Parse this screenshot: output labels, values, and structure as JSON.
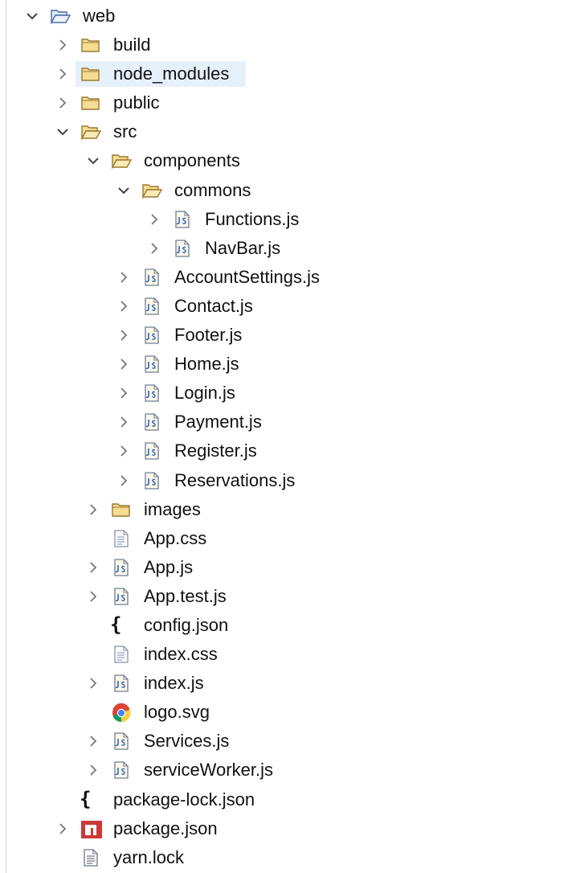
{
  "tree": {
    "root": {
      "label": "web",
      "icon": "project-folder-icon",
      "expanded": true
    },
    "rows": [
      {
        "label": "web",
        "icon": "project-folder-open-icon",
        "twisty": "expanded",
        "depth": 0
      },
      {
        "label": "build",
        "icon": "folder-icon",
        "twisty": "collapsed",
        "depth": 1
      },
      {
        "label": "node_modules",
        "icon": "folder-icon",
        "twisty": "collapsed",
        "depth": 1,
        "selected": true
      },
      {
        "label": "public",
        "icon": "folder-icon",
        "twisty": "collapsed",
        "depth": 1
      },
      {
        "label": "src",
        "icon": "folder-open-icon",
        "twisty": "expanded",
        "depth": 1
      },
      {
        "label": "components",
        "icon": "folder-open-icon",
        "twisty": "expanded",
        "depth": 2
      },
      {
        "label": "commons",
        "icon": "folder-open-icon",
        "twisty": "expanded",
        "depth": 3
      },
      {
        "label": "Functions.js",
        "icon": "js-file-icon",
        "twisty": "collapsed",
        "depth": 4
      },
      {
        "label": "NavBar.js",
        "icon": "js-file-icon",
        "twisty": "collapsed",
        "depth": 4
      },
      {
        "label": "AccountSettings.js",
        "icon": "js-file-icon",
        "twisty": "collapsed",
        "depth": 3
      },
      {
        "label": "Contact.js",
        "icon": "js-file-icon",
        "twisty": "collapsed",
        "depth": 3
      },
      {
        "label": "Footer.js",
        "icon": "js-file-icon",
        "twisty": "collapsed",
        "depth": 3
      },
      {
        "label": "Home.js",
        "icon": "js-file-icon",
        "twisty": "collapsed",
        "depth": 3
      },
      {
        "label": "Login.js",
        "icon": "js-file-icon",
        "twisty": "collapsed",
        "depth": 3
      },
      {
        "label": "Payment.js",
        "icon": "js-file-icon",
        "twisty": "collapsed",
        "depth": 3
      },
      {
        "label": "Register.js",
        "icon": "js-file-icon",
        "twisty": "collapsed",
        "depth": 3
      },
      {
        "label": "Reservations.js",
        "icon": "js-file-icon",
        "twisty": "collapsed",
        "depth": 3
      },
      {
        "label": "images",
        "icon": "folder-icon",
        "twisty": "collapsed",
        "depth": 2
      },
      {
        "label": "App.css",
        "icon": "css-file-icon",
        "twisty": "none",
        "depth": 2
      },
      {
        "label": "App.js",
        "icon": "js-file-icon",
        "twisty": "collapsed",
        "depth": 2
      },
      {
        "label": "App.test.js",
        "icon": "js-file-icon",
        "twisty": "collapsed",
        "depth": 2
      },
      {
        "label": "config.json",
        "icon": "json-file-icon",
        "twisty": "none",
        "depth": 2
      },
      {
        "label": "index.css",
        "icon": "css-file-icon",
        "twisty": "none",
        "depth": 2
      },
      {
        "label": "index.js",
        "icon": "js-file-icon",
        "twisty": "collapsed",
        "depth": 2
      },
      {
        "label": "logo.svg",
        "icon": "chrome-icon",
        "twisty": "none",
        "depth": 2
      },
      {
        "label": "Services.js",
        "icon": "js-file-icon",
        "twisty": "collapsed",
        "depth": 2
      },
      {
        "label": "serviceWorker.js",
        "icon": "js-file-icon",
        "twisty": "collapsed",
        "depth": 2
      },
      {
        "label": "package-lock.json",
        "icon": "json-file-icon",
        "twisty": "none",
        "depth": 1
      },
      {
        "label": "package.json",
        "icon": "npm-icon",
        "twisty": "collapsed",
        "depth": 1
      },
      {
        "label": "yarn.lock",
        "icon": "text-file-icon",
        "twisty": "none",
        "depth": 1
      }
    ]
  },
  "colors": {
    "selection": "#e6f0fb",
    "folder_fill": "#f7dc93",
    "folder_stroke": "#9a7a2e",
    "project_folder_fill": "#dfe9f7",
    "project_folder_stroke": "#4a6d9e",
    "npm_red": "#cb3837",
    "twisty": "#777777"
  }
}
